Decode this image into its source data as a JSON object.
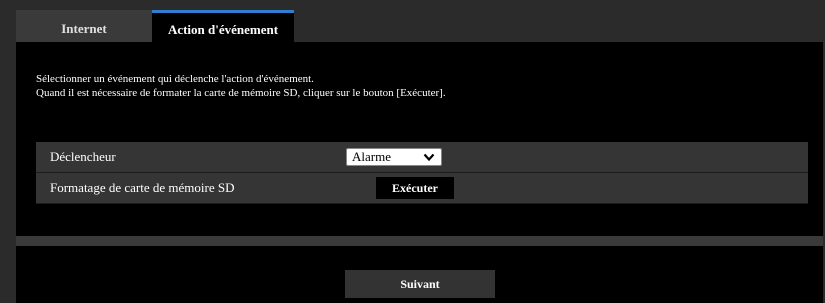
{
  "tabs": [
    {
      "label": "Internet",
      "active": false
    },
    {
      "label": "Action d'événement",
      "active": true
    }
  ],
  "description": {
    "line1": "Sélectionner un événement qui déclenche l'action d'événement.",
    "line2": "Quand il est nécessaire de formater la carte de mémoire SD, cliquer sur le bouton [Exécuter]."
  },
  "settings": {
    "trigger_label": "Déclencheur",
    "trigger_value": "Alarme",
    "sd_format_label": "Formatage de carte de mémoire SD",
    "execute_label": "Exécuter"
  },
  "footer": {
    "next_label": "Suivant"
  },
  "colors": {
    "active_tab_accent": "#2f7fd0",
    "background": "#2b2b2b",
    "panel": "#000000"
  }
}
